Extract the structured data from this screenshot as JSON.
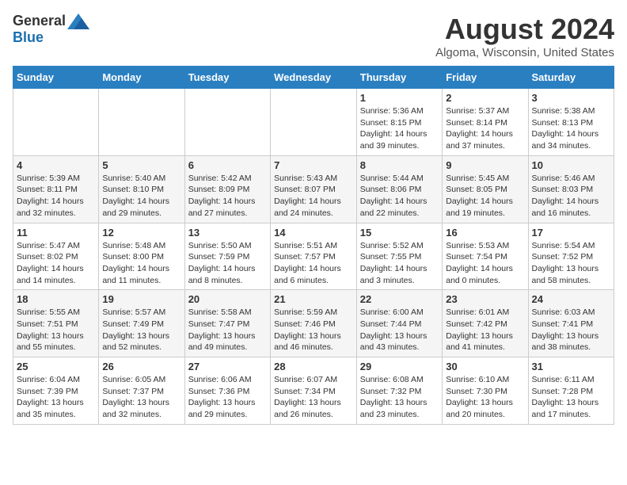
{
  "logo": {
    "general": "General",
    "blue": "Blue"
  },
  "header": {
    "month": "August 2024",
    "location": "Algoma, Wisconsin, United States"
  },
  "days_of_week": [
    "Sunday",
    "Monday",
    "Tuesday",
    "Wednesday",
    "Thursday",
    "Friday",
    "Saturday"
  ],
  "weeks": [
    [
      {
        "day": "",
        "info": ""
      },
      {
        "day": "",
        "info": ""
      },
      {
        "day": "",
        "info": ""
      },
      {
        "day": "",
        "info": ""
      },
      {
        "day": "1",
        "info": "Sunrise: 5:36 AM\nSunset: 8:15 PM\nDaylight: 14 hours and 39 minutes."
      },
      {
        "day": "2",
        "info": "Sunrise: 5:37 AM\nSunset: 8:14 PM\nDaylight: 14 hours and 37 minutes."
      },
      {
        "day": "3",
        "info": "Sunrise: 5:38 AM\nSunset: 8:13 PM\nDaylight: 14 hours and 34 minutes."
      }
    ],
    [
      {
        "day": "4",
        "info": "Sunrise: 5:39 AM\nSunset: 8:11 PM\nDaylight: 14 hours and 32 minutes."
      },
      {
        "day": "5",
        "info": "Sunrise: 5:40 AM\nSunset: 8:10 PM\nDaylight: 14 hours and 29 minutes."
      },
      {
        "day": "6",
        "info": "Sunrise: 5:42 AM\nSunset: 8:09 PM\nDaylight: 14 hours and 27 minutes."
      },
      {
        "day": "7",
        "info": "Sunrise: 5:43 AM\nSunset: 8:07 PM\nDaylight: 14 hours and 24 minutes."
      },
      {
        "day": "8",
        "info": "Sunrise: 5:44 AM\nSunset: 8:06 PM\nDaylight: 14 hours and 22 minutes."
      },
      {
        "day": "9",
        "info": "Sunrise: 5:45 AM\nSunset: 8:05 PM\nDaylight: 14 hours and 19 minutes."
      },
      {
        "day": "10",
        "info": "Sunrise: 5:46 AM\nSunset: 8:03 PM\nDaylight: 14 hours and 16 minutes."
      }
    ],
    [
      {
        "day": "11",
        "info": "Sunrise: 5:47 AM\nSunset: 8:02 PM\nDaylight: 14 hours and 14 minutes."
      },
      {
        "day": "12",
        "info": "Sunrise: 5:48 AM\nSunset: 8:00 PM\nDaylight: 14 hours and 11 minutes."
      },
      {
        "day": "13",
        "info": "Sunrise: 5:50 AM\nSunset: 7:59 PM\nDaylight: 14 hours and 8 minutes."
      },
      {
        "day": "14",
        "info": "Sunrise: 5:51 AM\nSunset: 7:57 PM\nDaylight: 14 hours and 6 minutes."
      },
      {
        "day": "15",
        "info": "Sunrise: 5:52 AM\nSunset: 7:55 PM\nDaylight: 14 hours and 3 minutes."
      },
      {
        "day": "16",
        "info": "Sunrise: 5:53 AM\nSunset: 7:54 PM\nDaylight: 14 hours and 0 minutes."
      },
      {
        "day": "17",
        "info": "Sunrise: 5:54 AM\nSunset: 7:52 PM\nDaylight: 13 hours and 58 minutes."
      }
    ],
    [
      {
        "day": "18",
        "info": "Sunrise: 5:55 AM\nSunset: 7:51 PM\nDaylight: 13 hours and 55 minutes."
      },
      {
        "day": "19",
        "info": "Sunrise: 5:57 AM\nSunset: 7:49 PM\nDaylight: 13 hours and 52 minutes."
      },
      {
        "day": "20",
        "info": "Sunrise: 5:58 AM\nSunset: 7:47 PM\nDaylight: 13 hours and 49 minutes."
      },
      {
        "day": "21",
        "info": "Sunrise: 5:59 AM\nSunset: 7:46 PM\nDaylight: 13 hours and 46 minutes."
      },
      {
        "day": "22",
        "info": "Sunrise: 6:00 AM\nSunset: 7:44 PM\nDaylight: 13 hours and 43 minutes."
      },
      {
        "day": "23",
        "info": "Sunrise: 6:01 AM\nSunset: 7:42 PM\nDaylight: 13 hours and 41 minutes."
      },
      {
        "day": "24",
        "info": "Sunrise: 6:03 AM\nSunset: 7:41 PM\nDaylight: 13 hours and 38 minutes."
      }
    ],
    [
      {
        "day": "25",
        "info": "Sunrise: 6:04 AM\nSunset: 7:39 PM\nDaylight: 13 hours and 35 minutes."
      },
      {
        "day": "26",
        "info": "Sunrise: 6:05 AM\nSunset: 7:37 PM\nDaylight: 13 hours and 32 minutes."
      },
      {
        "day": "27",
        "info": "Sunrise: 6:06 AM\nSunset: 7:36 PM\nDaylight: 13 hours and 29 minutes."
      },
      {
        "day": "28",
        "info": "Sunrise: 6:07 AM\nSunset: 7:34 PM\nDaylight: 13 hours and 26 minutes."
      },
      {
        "day": "29",
        "info": "Sunrise: 6:08 AM\nSunset: 7:32 PM\nDaylight: 13 hours and 23 minutes."
      },
      {
        "day": "30",
        "info": "Sunrise: 6:10 AM\nSunset: 7:30 PM\nDaylight: 13 hours and 20 minutes."
      },
      {
        "day": "31",
        "info": "Sunrise: 6:11 AM\nSunset: 7:28 PM\nDaylight: 13 hours and 17 minutes."
      }
    ]
  ]
}
